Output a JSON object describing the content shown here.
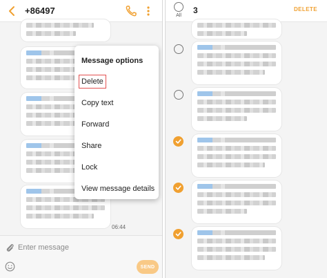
{
  "conversation": {
    "contact": "+86497",
    "time": "06:44"
  },
  "message_options": {
    "title": "Message options",
    "items": [
      "Delete",
      "Copy text",
      "Forward",
      "Share",
      "Lock",
      "View message details"
    ]
  },
  "composer": {
    "placeholder": "Enter message",
    "send_label": "SEND"
  },
  "selection": {
    "all_label": "All",
    "count": "3",
    "delete_label": "DELETE",
    "rows": [
      {
        "checked": false
      },
      {
        "checked": false
      },
      {
        "checked": true
      },
      {
        "checked": true
      },
      {
        "checked": true
      }
    ]
  },
  "colors": {
    "accent": "#f0a030",
    "highlight_border": "#e25050",
    "send_disabled": "#f9c986"
  },
  "icons": [
    "back-arrow-icon",
    "phone-icon",
    "more-vertical-icon",
    "paperclip-icon",
    "emoji-icon",
    "check-icon"
  ]
}
